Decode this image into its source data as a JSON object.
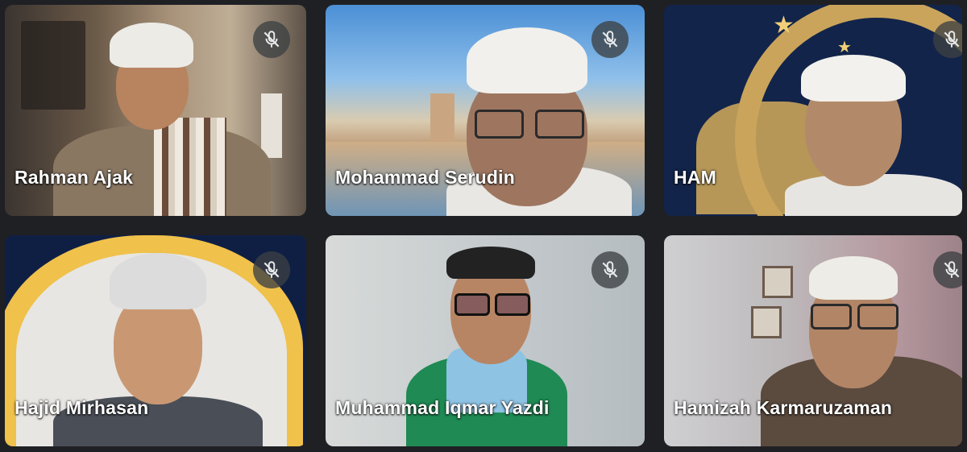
{
  "meeting": {
    "participants": [
      {
        "name": "Rahman Ajak",
        "muted": true
      },
      {
        "name": "Mohammad Serudin",
        "muted": true
      },
      {
        "name": "HAM",
        "muted": true
      },
      {
        "name": "Hajid Mirhasan",
        "muted": true
      },
      {
        "name": "Muhammad Iqmar Yazdi",
        "muted": true
      },
      {
        "name": "Hamizah Karmaruzaman",
        "muted": true
      }
    ]
  },
  "icons": {
    "muted": "mic-off-icon"
  },
  "colors": {
    "grid_background": "#1f2024",
    "mute_badge": "#3c4043",
    "name_text": "#ffffff"
  }
}
